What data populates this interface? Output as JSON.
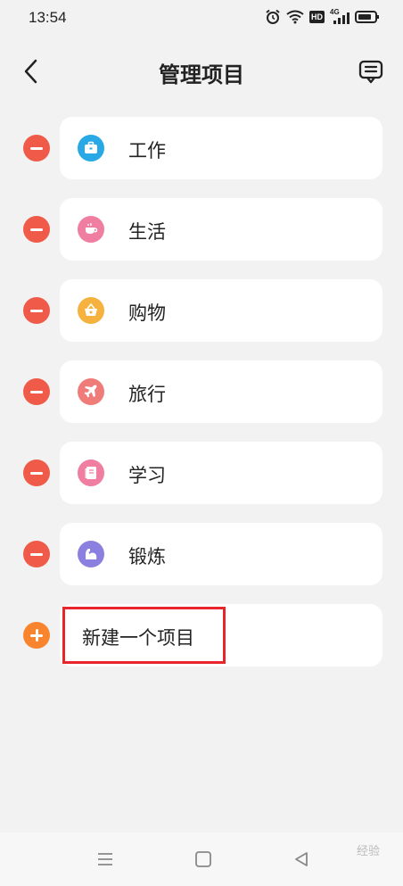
{
  "status_bar": {
    "time": "13:54",
    "icons": [
      "alarm-icon",
      "wifi-icon",
      "hd-icon",
      "signal-4g-icon",
      "battery-icon"
    ],
    "hd_label": "HD",
    "network_label": "4G"
  },
  "header": {
    "title": "管理项目",
    "back_icon": "chevron-left-icon",
    "feedback_icon": "feedback-icon"
  },
  "items": [
    {
      "label": "工作",
      "icon": "briefcase-icon",
      "color": "#29a8e6"
    },
    {
      "label": "生活",
      "icon": "cup-icon",
      "color": "#f07ea1"
    },
    {
      "label": "购物",
      "icon": "basket-icon",
      "color": "#f5b23e"
    },
    {
      "label": "旅行",
      "icon": "airplane-icon",
      "color": "#f07c7a"
    },
    {
      "label": "学习",
      "icon": "book-icon",
      "color": "#f07ea1"
    },
    {
      "label": "锻炼",
      "icon": "muscle-icon",
      "color": "#8b7fe0"
    }
  ],
  "new_item": {
    "label": "新建一个项目",
    "icon": "plus-icon",
    "color": "#f8842d"
  },
  "colors": {
    "remove": "#f05a49",
    "highlight": "#e8252a",
    "background": "#f2f2f2"
  },
  "nav_bar": {
    "icons": [
      "menu-icon",
      "home-square-icon",
      "back-triangle-icon"
    ],
    "watermark": "经验"
  }
}
